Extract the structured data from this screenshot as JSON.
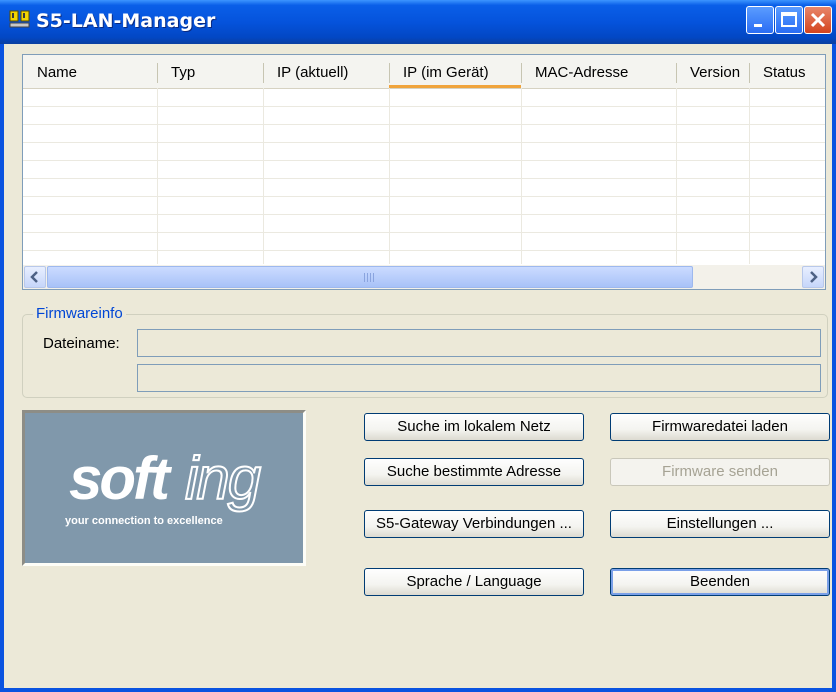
{
  "window": {
    "title": "S5-LAN-Manager"
  },
  "list": {
    "columns": [
      "Name",
      "Typ",
      "IP (aktuell)",
      "IP (im Gerät)",
      "MAC-Adresse",
      "Version",
      "Status"
    ],
    "rows": []
  },
  "firmware": {
    "group_label": "Firmwareinfo",
    "file_label": "Dateiname:",
    "file_value": "",
    "info_value": ""
  },
  "logo": {
    "brand": "softing",
    "tagline": "your connection to excellence"
  },
  "buttons": {
    "search_local": "Suche im lokalem Netz",
    "search_address": "Suche bestimmte Adresse",
    "gateway_connections": "S5-Gateway Verbindungen ...",
    "language": "Sprache / Language",
    "load_firmware": "Firmwaredatei laden",
    "send_firmware": "Firmware senden",
    "settings": "Einstellungen ...",
    "exit": "Beenden"
  },
  "colors": {
    "titlebar": "#0553dc",
    "logo_bg": "#8098ab",
    "group_label": "#0046d5"
  }
}
